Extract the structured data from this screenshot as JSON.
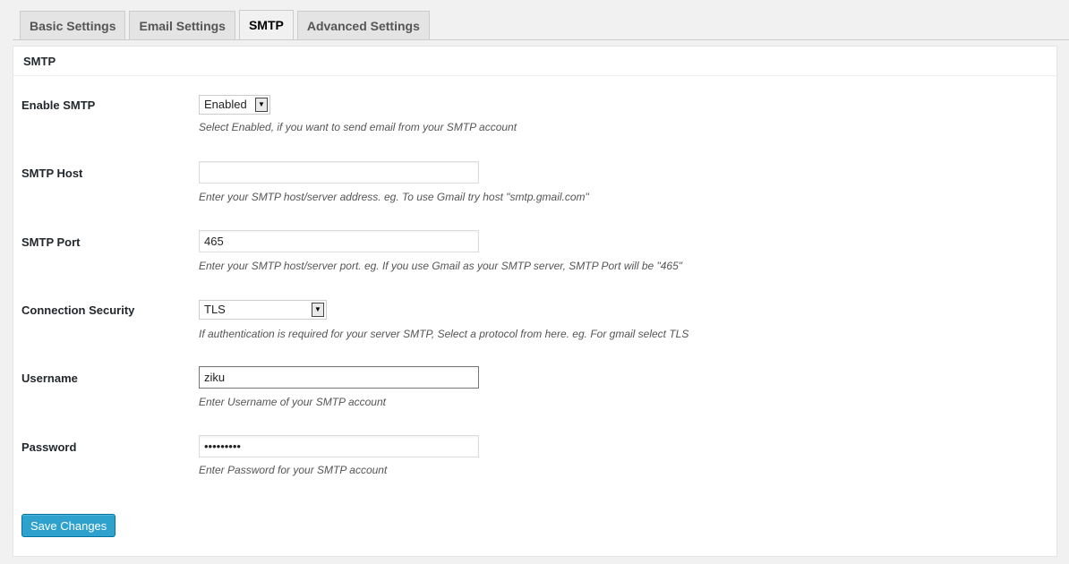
{
  "tabs": [
    {
      "label": "Basic Settings"
    },
    {
      "label": "Email Settings"
    },
    {
      "label": "SMTP"
    },
    {
      "label": "Advanced Settings"
    }
  ],
  "active_tab": "SMTP",
  "panel": {
    "title": "SMTP",
    "fields": {
      "enable_smtp": {
        "label": "Enable SMTP",
        "value": "Enabled",
        "description": "Select Enabled, if you want to send email from your SMTP account"
      },
      "smtp_host": {
        "label": "SMTP Host",
        "value": "",
        "description": "Enter your SMTP host/server address. eg. To use Gmail try host \"smtp.gmail.com\""
      },
      "smtp_port": {
        "label": "SMTP Port",
        "value": "465",
        "description": "Enter your SMTP host/server port. eg. If you use Gmail as your SMTP server, SMTP Port will be \"465\""
      },
      "connection_security": {
        "label": "Connection Security",
        "value": "TLS",
        "description": "If authentication is required for your server SMTP, Select a protocol from here. eg. For gmail select TLS"
      },
      "username": {
        "label": "Username",
        "value": "ziku",
        "description": "Enter Username of your SMTP account"
      },
      "password": {
        "label": "Password",
        "value": "•••••••••",
        "description": "Enter Password for your SMTP account"
      }
    },
    "save_label": "Save Changes"
  },
  "colors": {
    "background": "#f1f1f1",
    "panel": "#ffffff",
    "primary_button": "#2ea2cc",
    "primary_button_border": "#0074a2"
  }
}
